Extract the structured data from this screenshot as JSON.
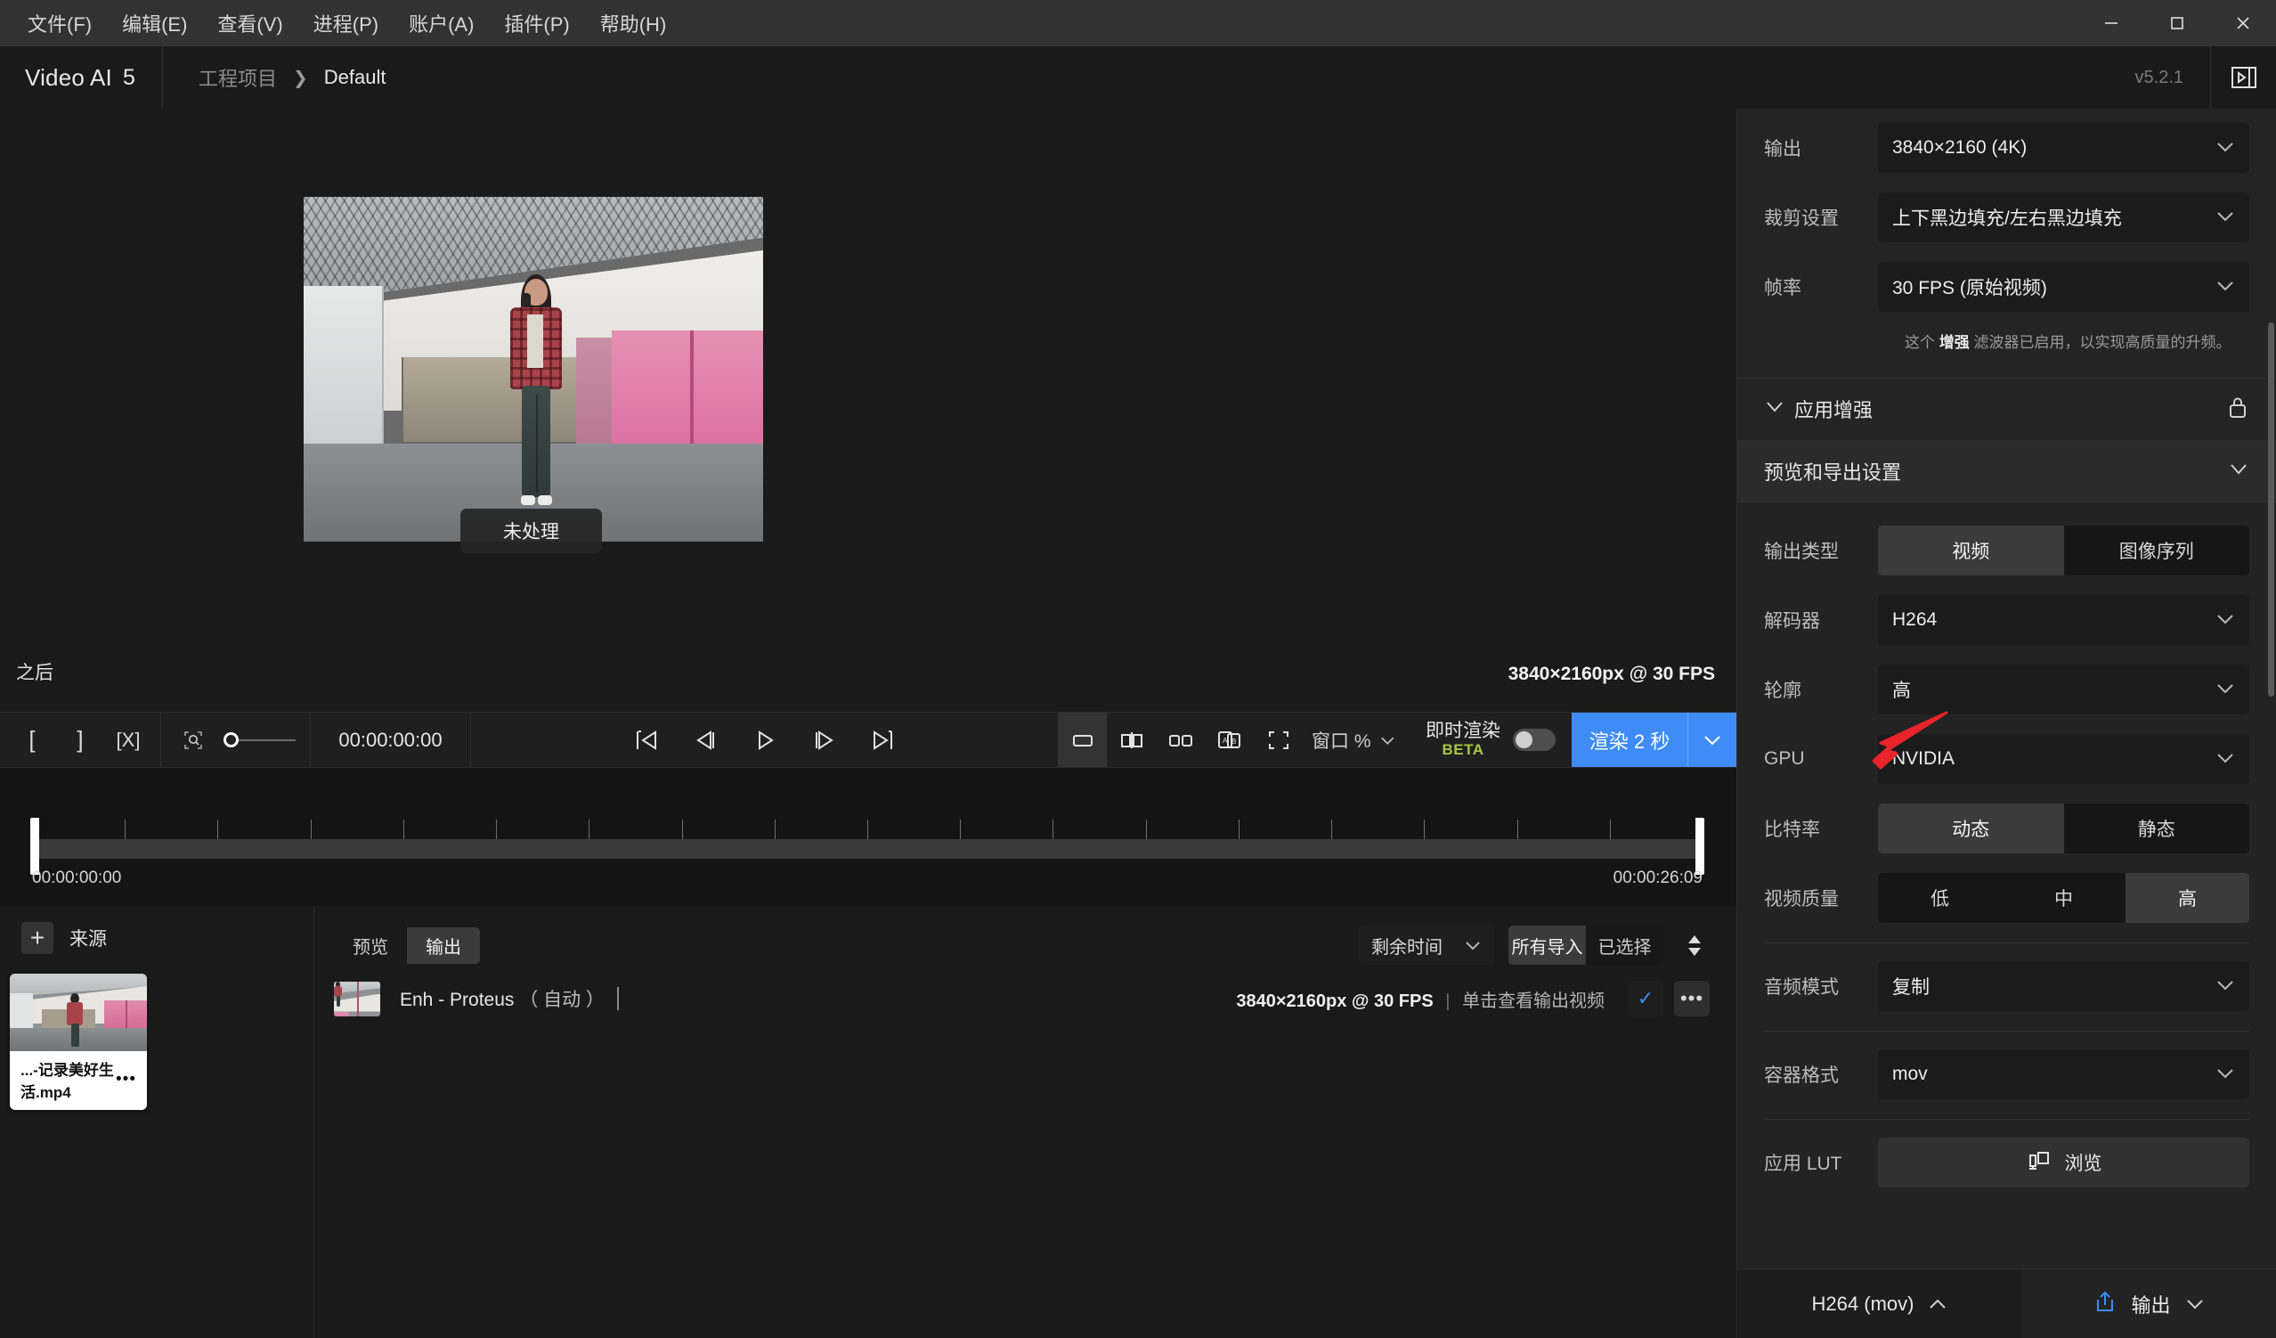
{
  "menubar": {
    "items": [
      {
        "label": "文件(F)",
        "name": "menu-file"
      },
      {
        "label": "编辑(E)",
        "name": "menu-edit"
      },
      {
        "label": "查看(V)",
        "name": "menu-view"
      },
      {
        "label": "进程(P)",
        "name": "menu-process"
      },
      {
        "label": "账户(A)",
        "name": "menu-account"
      },
      {
        "label": "插件(P)",
        "name": "menu-plugins"
      },
      {
        "label": "帮助(H)",
        "name": "menu-help"
      }
    ],
    "window_controls": {
      "minimize": "—",
      "maximize": "▢",
      "close": "✕"
    }
  },
  "titlebar": {
    "app_name": "Video AI",
    "app_major": "5",
    "breadcrumb": {
      "root": "工程项目",
      "separator": "❯",
      "current": "Default"
    },
    "version": "v5.2.1"
  },
  "stage": {
    "badge": "未处理",
    "after_label": "之后",
    "resolution": "3840×2160px @ 30 FPS"
  },
  "transport": {
    "mark_in": "[",
    "mark_out": "]",
    "clear_marks": "[X]",
    "timecode": "00:00:00:00",
    "fit_label": "窗口 %",
    "live_render": {
      "title": "即时渲染",
      "beta": "BETA",
      "enabled": false
    },
    "render_button": "渲染 2 秒"
  },
  "timeline": {
    "start": "00:00:00:00",
    "end": "00:00:26:09",
    "tick_count": 17
  },
  "sources": {
    "title": "来源",
    "add_label": "+",
    "items": [
      {
        "filename": "...-记录美好生活.mp4",
        "more": "•••"
      }
    ]
  },
  "output_panel": {
    "tabs": [
      {
        "label": "预览",
        "selected": false
      },
      {
        "label": "输出",
        "selected": true
      }
    ],
    "sort_select": "剩余时间",
    "filters": [
      {
        "label": "所有导入",
        "selected": true
      },
      {
        "label": "已选择",
        "selected": false
      }
    ],
    "rows": [
      {
        "name": "Enh - Proteus",
        "mode": "（ 自动 ）",
        "meta": "3840×2160px @ 30 FPS",
        "hint": "单击查看输出视频",
        "check": "✓",
        "more": "•••"
      }
    ]
  },
  "right_panel": {
    "basic": [
      {
        "label": "输出",
        "value": "3840×2160 (4K)",
        "name": "output-resolution"
      },
      {
        "label": "裁剪设置",
        "value": "上下黑边填充/左右黑边填充",
        "name": "crop-settings"
      },
      {
        "label": "帧率",
        "value": "30 FPS (原始视频)",
        "name": "frame-rate"
      }
    ],
    "hint_prefix": "这个 ",
    "hint_bold": "增强",
    "hint_suffix": " 滤波器已启用，以实现高质量的升频。",
    "sections": [
      {
        "title": "应用增强",
        "name": "apply-enhancement",
        "icon": "lock-icon",
        "expanded": true
      },
      {
        "title": "预览和导出设置",
        "name": "preview-export-settings",
        "expanded": true
      }
    ],
    "export": {
      "output_type": {
        "label": "输出类型",
        "options": [
          {
            "label": "视频",
            "selected": true
          },
          {
            "label": "图像序列",
            "selected": false
          }
        ]
      },
      "decoder": {
        "label": "解码器",
        "value": "H264"
      },
      "profile": {
        "label": "轮廓",
        "value": "高"
      },
      "gpu": {
        "label": "GPU",
        "value": "NVIDIA"
      },
      "bitrate": {
        "label": "比特率",
        "options": [
          {
            "label": "动态",
            "selected": true
          },
          {
            "label": "静态",
            "selected": false
          }
        ]
      },
      "video_quality": {
        "label": "视频质量",
        "options": [
          {
            "label": "低",
            "selected": false
          },
          {
            "label": "中",
            "selected": false
          },
          {
            "label": "高",
            "selected": true
          }
        ]
      },
      "audio_mode": {
        "label": "音频模式",
        "value": "复制"
      },
      "container": {
        "label": "容器格式",
        "value": "mov"
      },
      "lut": {
        "label": "应用 LUT",
        "button": "浏览"
      }
    },
    "footer": {
      "codec_summary": "H264 (mov)",
      "export_label": "输出"
    }
  },
  "colors": {
    "accent": "#3f8cf7",
    "beta": "#a9c63f",
    "panel_bg": "#232323",
    "cursor_red": "#e8232a"
  }
}
